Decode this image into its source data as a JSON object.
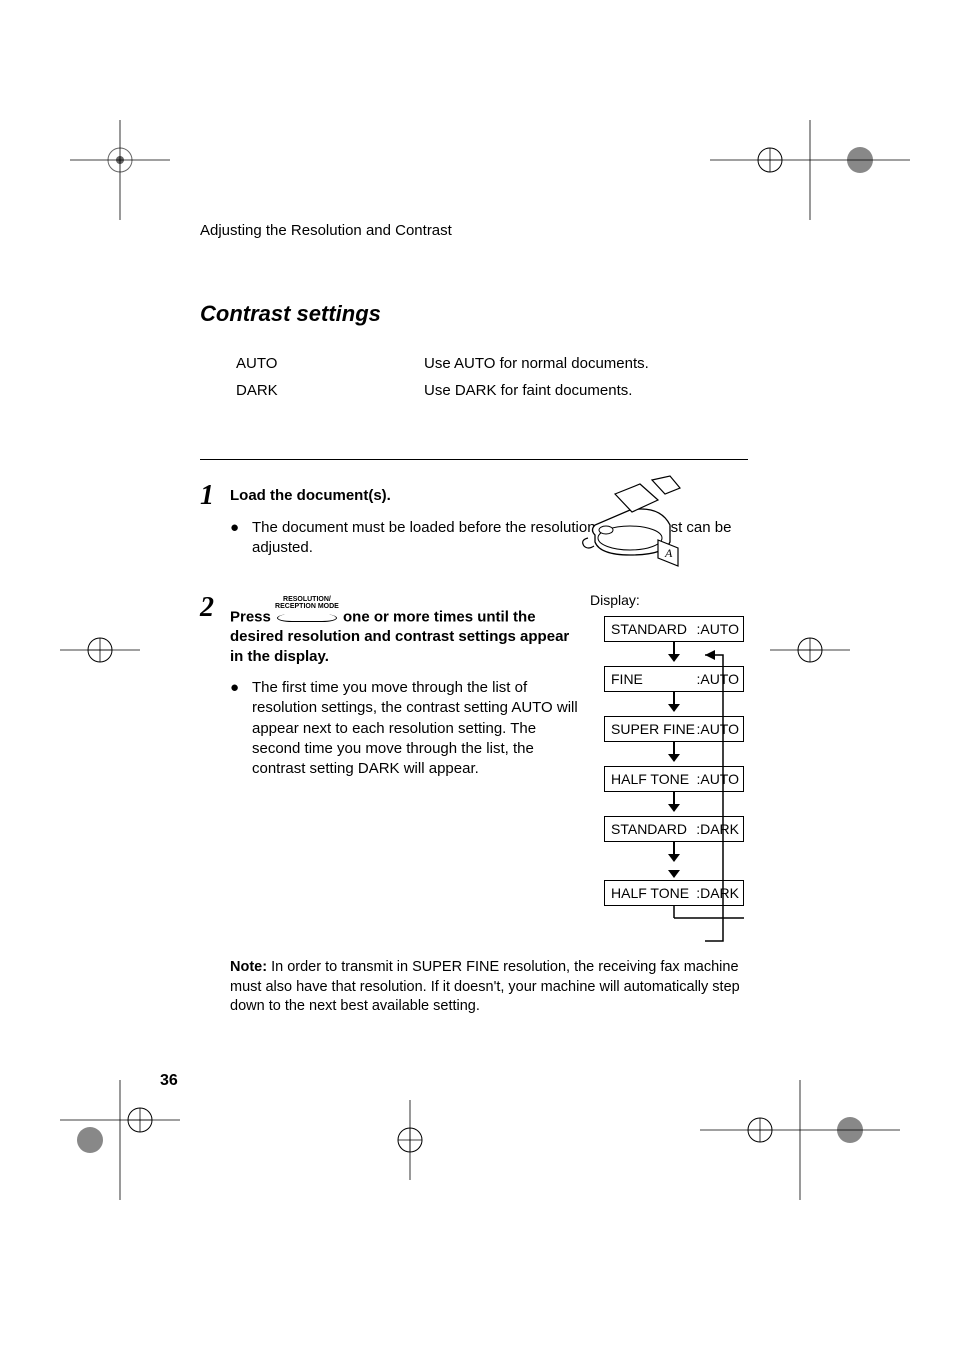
{
  "header": "Adjusting the Resolution and Contrast",
  "section_title": "Contrast settings",
  "table": [
    {
      "label": "AUTO",
      "desc": "Use AUTO for normal documents."
    },
    {
      "label": "DARK",
      "desc": "Use DARK for faint documents."
    }
  ],
  "step1": {
    "num": "1",
    "title": "Load the document(s).",
    "bullet": "The document must be loaded before the resolution and contrast can be adjusted."
  },
  "step2": {
    "num": "2",
    "press": "Press",
    "button_top": "RESOLUTION/",
    "button_bottom": "RECEPTION MODE",
    "rest": "one or more times until the desired resolution and contrast settings appear in the display.",
    "bullet": "The first time you move through the list of resolution settings, the contrast setting AUTO will appear next to each resolution setting. The second time you move through the list, the contrast setting DARK will appear.",
    "display_label": "Display:",
    "displays": [
      {
        "left": "STANDARD",
        "right": ":AUTO"
      },
      {
        "left": "FINE",
        "right": ":AUTO"
      },
      {
        "left": "SUPER FINE",
        "right": ":AUTO"
      },
      {
        "left": "HALF TONE",
        "right": ":AUTO"
      },
      {
        "left": "STANDARD",
        "right": ":DARK"
      },
      {
        "left": "HALF TONE",
        "right": ":DARK"
      }
    ]
  },
  "note": {
    "label": "Note:",
    "text": " In order to transmit in SUPER FINE resolution, the receiving fax machine must also have that resolution. If it doesn't, your machine will automatically step down to the next best available setting."
  },
  "page_number": "36"
}
